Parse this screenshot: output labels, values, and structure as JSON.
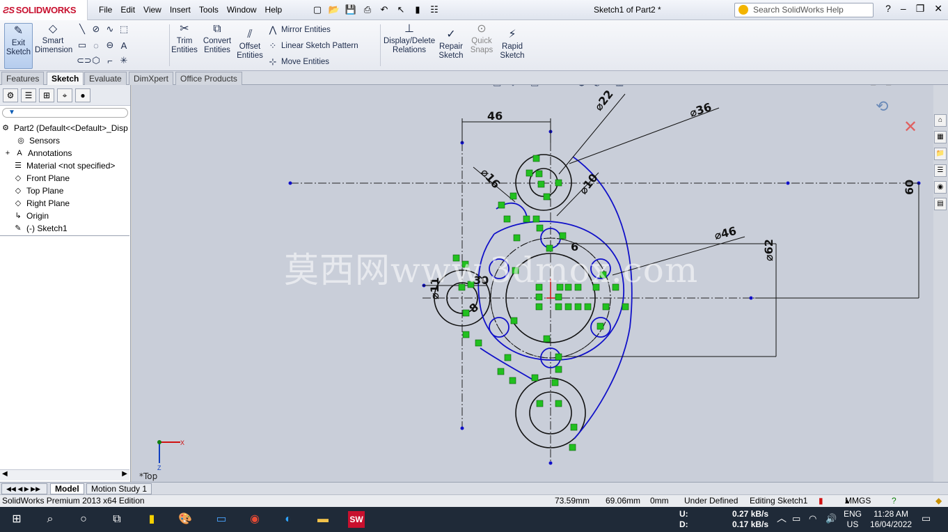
{
  "app": {
    "logo": "SOLIDWORKS",
    "doc_title": "Sketch1 of Part2 *",
    "search_placeholder": "Search SolidWorks Help"
  },
  "menu": [
    "File",
    "Edit",
    "View",
    "Insert",
    "Tools",
    "Window",
    "Help"
  ],
  "toolbar": {
    "exit_sketch": "Exit Sketch",
    "smart_dimension": "Smart Dimension",
    "trim_entities": "Trim Entities",
    "convert_entities": "Convert Entities",
    "offset_entities": "Offset Entities",
    "mirror_entities": "Mirror Entities",
    "linear_sketch_pattern": "Linear Sketch Pattern",
    "move_entities": "Move Entities",
    "display_delete_relations": "Display/Delete Relations",
    "repair_sketch": "Repair Sketch",
    "quick_snaps": "Quick Snaps",
    "rapid_sketch": "Rapid Sketch"
  },
  "tabs": [
    "Features",
    "Sketch",
    "Evaluate",
    "DimXpert",
    "Office Products"
  ],
  "active_tab": "Sketch",
  "tree": {
    "root": "Part2  (Default<<Default>_Disp",
    "items": [
      "Sensors",
      "Annotations",
      "Material <not specified>",
      "Front Plane",
      "Top Plane",
      "Right Plane",
      "Origin",
      "(-) Sketch1"
    ]
  },
  "view_label": "*Top",
  "dimensions": {
    "d46": "46",
    "d22": "⌀22",
    "d36": "⌀36",
    "d16": "⌀16",
    "d10": "⌀10",
    "d60": "60",
    "d6": "6",
    "d46b": "⌀46",
    "d62": "⌀62",
    "d30": "30",
    "d11": "⌀11",
    "d8": "8"
  },
  "triad": {
    "x": "X",
    "z": "Z"
  },
  "watermark": "莫西网www.3dmox.com",
  "bottom_tabs": [
    "Model",
    "Motion Study 1"
  ],
  "status": {
    "edition": "SolidWorks Premium 2013 x64 Edition",
    "x": "73.59mm",
    "y": "69.06mm",
    "z": "0mm",
    "state": "Under Defined",
    "editing": "Editing Sketch1",
    "units": "MMGS"
  },
  "taskbar": {
    "upload_label": "U:",
    "download_label": "D:",
    "upload": "0.27 kB/s",
    "download": "0.17 kB/s",
    "lang": "ENG",
    "region": "US",
    "time": "11:28 AM",
    "date": "16/04/2022"
  },
  "colors": {
    "sketch": "#1010c8",
    "relation": "#22c020",
    "canvas": "#c9ced9"
  }
}
